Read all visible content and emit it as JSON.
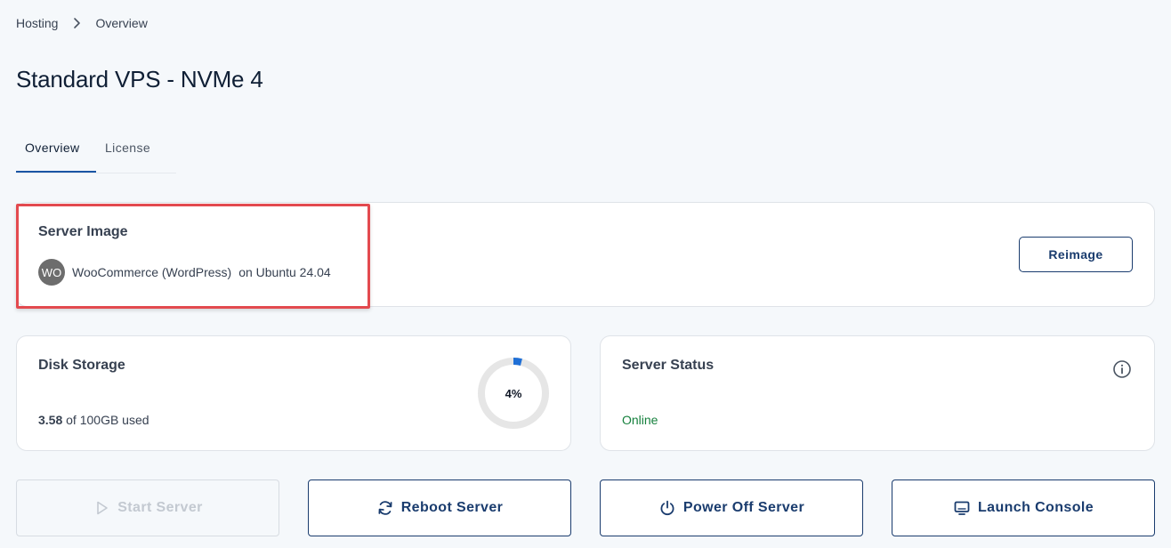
{
  "breadcrumb": {
    "items": [
      "Hosting",
      "Overview"
    ]
  },
  "page": {
    "title": "Standard VPS - NVMe 4"
  },
  "tabs": [
    {
      "label": "Overview",
      "active": true
    },
    {
      "label": "License",
      "active": false
    }
  ],
  "server_image": {
    "title": "Server Image",
    "badge": "WO",
    "app": "WooCommerce (WordPress)",
    "os": "on Ubuntu 24.04",
    "reimage_label": "Reimage"
  },
  "disk_storage": {
    "title": "Disk Storage",
    "used": "3.58",
    "used_suffix": " of 100GB used",
    "percent_label": "4%",
    "percent": 0.04
  },
  "server_status": {
    "title": "Server Status",
    "value": "Online",
    "value_color": "#15803d"
  },
  "actions": {
    "start": {
      "label": "Start Server",
      "icon": "play-icon",
      "disabled": true
    },
    "reboot": {
      "label": "Reboot Server",
      "icon": "refresh-icon"
    },
    "poweroff": {
      "label": "Power Off Server",
      "icon": "power-icon"
    },
    "console": {
      "label": "Launch Console",
      "icon": "monitor-icon"
    }
  },
  "colors": {
    "accent": "#1a3c6e",
    "tab_underline": "#1a55a4",
    "highlight": "#e34a4f",
    "donut_fill": "#1f6fd6",
    "donut_track": "#e6e6e6"
  }
}
